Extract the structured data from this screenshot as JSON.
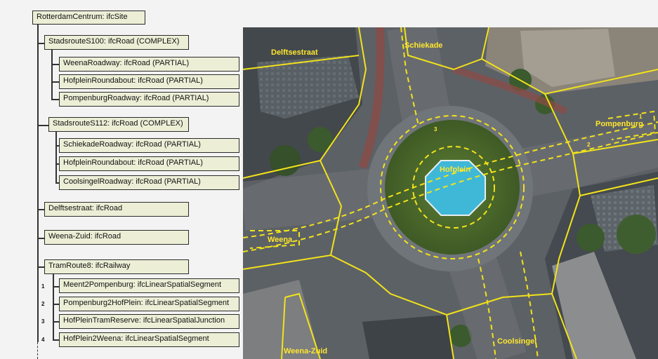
{
  "tree": {
    "root": "RotterdamCentrum: ifcSite",
    "s100": "StadsrouteS100: ifcRoad (COMPLEX)",
    "s100_children": [
      "WeenaRoadway: ifcRoad (PARTIAL)",
      "HofpleinRoundabout: ifcRoad (PARTIAL)",
      "PompenburgRoadway: ifcRoad (PARTIAL)"
    ],
    "s112": "StadsrouteS112: ifcRoad (COMPLEX)",
    "s112_children": [
      "SchiekadeRoadway: ifcRoad (PARTIAL)",
      "HofpleinRoundabout: ifcRoad (PARTIAL)",
      "CoolsingelRoadway: ifcRoad (PARTIAL)"
    ],
    "delftsestraat": "Delftsestraat: ifcRoad",
    "weena_zuid": "Weena-Zuid: ifcRoad",
    "tram": "TramRoute8: ifcRailway",
    "tram_children": [
      {
        "num": "1",
        "label": "Meent2Pompenburg: ifcLinearSpatialSegment"
      },
      {
        "num": "2",
        "label": "Pompenburg2HofPlein: ifcLinearSpatialSegment"
      },
      {
        "num": "3",
        "label": "HofPleinTramReserve: ifcLinearSpatialJunction"
      },
      {
        "num": "4",
        "label": "HofPlein2Weena: ifcLinearSpatialSegment"
      }
    ]
  },
  "map": {
    "labels": {
      "delftsestraat": "Delftsestraat",
      "schiekade": "Schiekade",
      "pompenburg": "Pompenburg",
      "hofplein": "Hofplein",
      "weena": "Weena",
      "weena_zuid": "Weena-Zuid",
      "coolsingel": "Coolsingel"
    },
    "segment_numbers": [
      "1",
      "2",
      "3"
    ],
    "colors": {
      "boundary": "#f2e21a",
      "label": "#ffe62e",
      "fountain": "#3fb8d8",
      "grass": "#4a6b2a"
    }
  }
}
